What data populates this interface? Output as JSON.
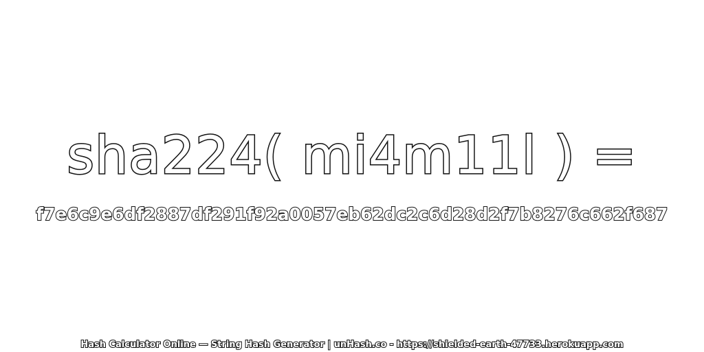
{
  "heading": {
    "expression": "sha224( mi4m11l ) ="
  },
  "result": {
    "hash": "f7e6c9e6df2887df291f92a0057eb62dc2c6d28d2f7b8276c662f687"
  },
  "footer": {
    "credit": "Hash Calculator Online — String Hash Generator | unHash.co - https://shielded-earth-47733.herokuapp.com"
  },
  "colors": {
    "background": "#ffffff",
    "text_fill": "#ffffff",
    "text_outline": "#111111"
  }
}
